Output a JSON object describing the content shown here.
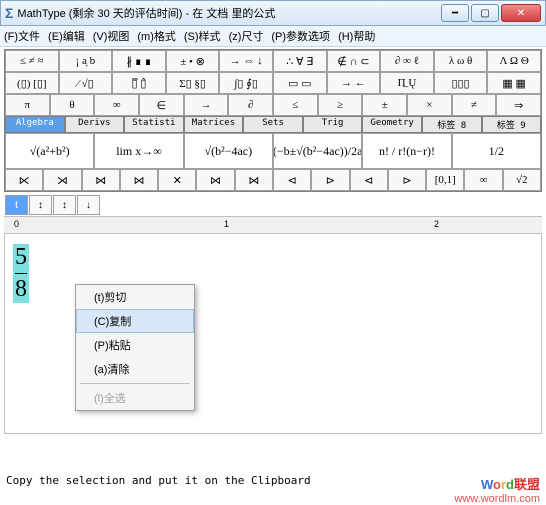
{
  "title": "MathType (剩余 30 天的评估时间) - 在 文档 里的公式",
  "menu": [
    "(F)文件",
    "(E)编辑",
    "(V)视图",
    "(m)格式",
    "(S)样式",
    "(z)尺寸",
    "(P)参数选项",
    "(H)帮助"
  ],
  "row1": [
    "≤ ≠ ≈",
    "¡ a͎ b",
    "∦ ∎ ∎",
    "± • ⊗",
    "→ ⇔ ↓",
    "∴ ∀ ∃",
    "∉ ∩ ⊂",
    "∂ ∞ ℓ",
    "λ ω θ",
    "Λ Ω Θ"
  ],
  "row2": [
    "(▯) [▯]",
    "⁄ √▯",
    "▯̅ ▯̂",
    "Σ▯ §▯",
    "∫▯ ∮▯",
    "▭ ▭",
    "→ ←",
    "Π̲ Ų",
    "▯▯▯",
    "▦ ▦"
  ],
  "row3": [
    "π",
    "θ",
    "∞",
    "∈",
    "→",
    "∂",
    "≤",
    "≥",
    "±",
    "×",
    "≠",
    "⇒"
  ],
  "tabs": [
    "Algebra",
    "Derivs",
    "Statisti",
    "Matrices",
    "Sets",
    "Trig",
    "Geometry",
    "标签 8",
    "标签 9"
  ],
  "templates": [
    "√(a²+b²)",
    "lim x→∞",
    "√(b²−4ac)",
    "(−b±√(b²−4ac))/2a",
    "n! / r!(n−r)!",
    "1/2"
  ],
  "row4": [
    "⋉",
    "⋊",
    "⋈",
    "⋈",
    "✕",
    "⋈",
    "⋈",
    "⊲",
    "⊳",
    "⊲",
    "⊳",
    "[0,1]",
    "∞",
    "√2"
  ],
  "iconrow": [
    "t",
    "↕",
    "↕",
    "↓"
  ],
  "ruler": {
    "marks": [
      {
        "pos": 10,
        "label": "0"
      },
      {
        "pos": 220,
        "label": "1"
      },
      {
        "pos": 430,
        "label": "2"
      }
    ]
  },
  "fraction": {
    "num": "5",
    "den": "8"
  },
  "context_menu": [
    {
      "label": "(t)剪切",
      "state": "normal"
    },
    {
      "label": "(C)复制",
      "state": "hover"
    },
    {
      "label": "(P)粘贴",
      "state": "normal"
    },
    {
      "label": "(a)清除",
      "state": "normal"
    },
    {
      "sep": true
    },
    {
      "label": "(l)全选",
      "state": "disabled"
    }
  ],
  "status": "Copy the selection and put it on the Clipboard",
  "watermark": {
    "brand": "Word",
    "suffix": "联盟",
    "url": "www.wordlm.com"
  }
}
